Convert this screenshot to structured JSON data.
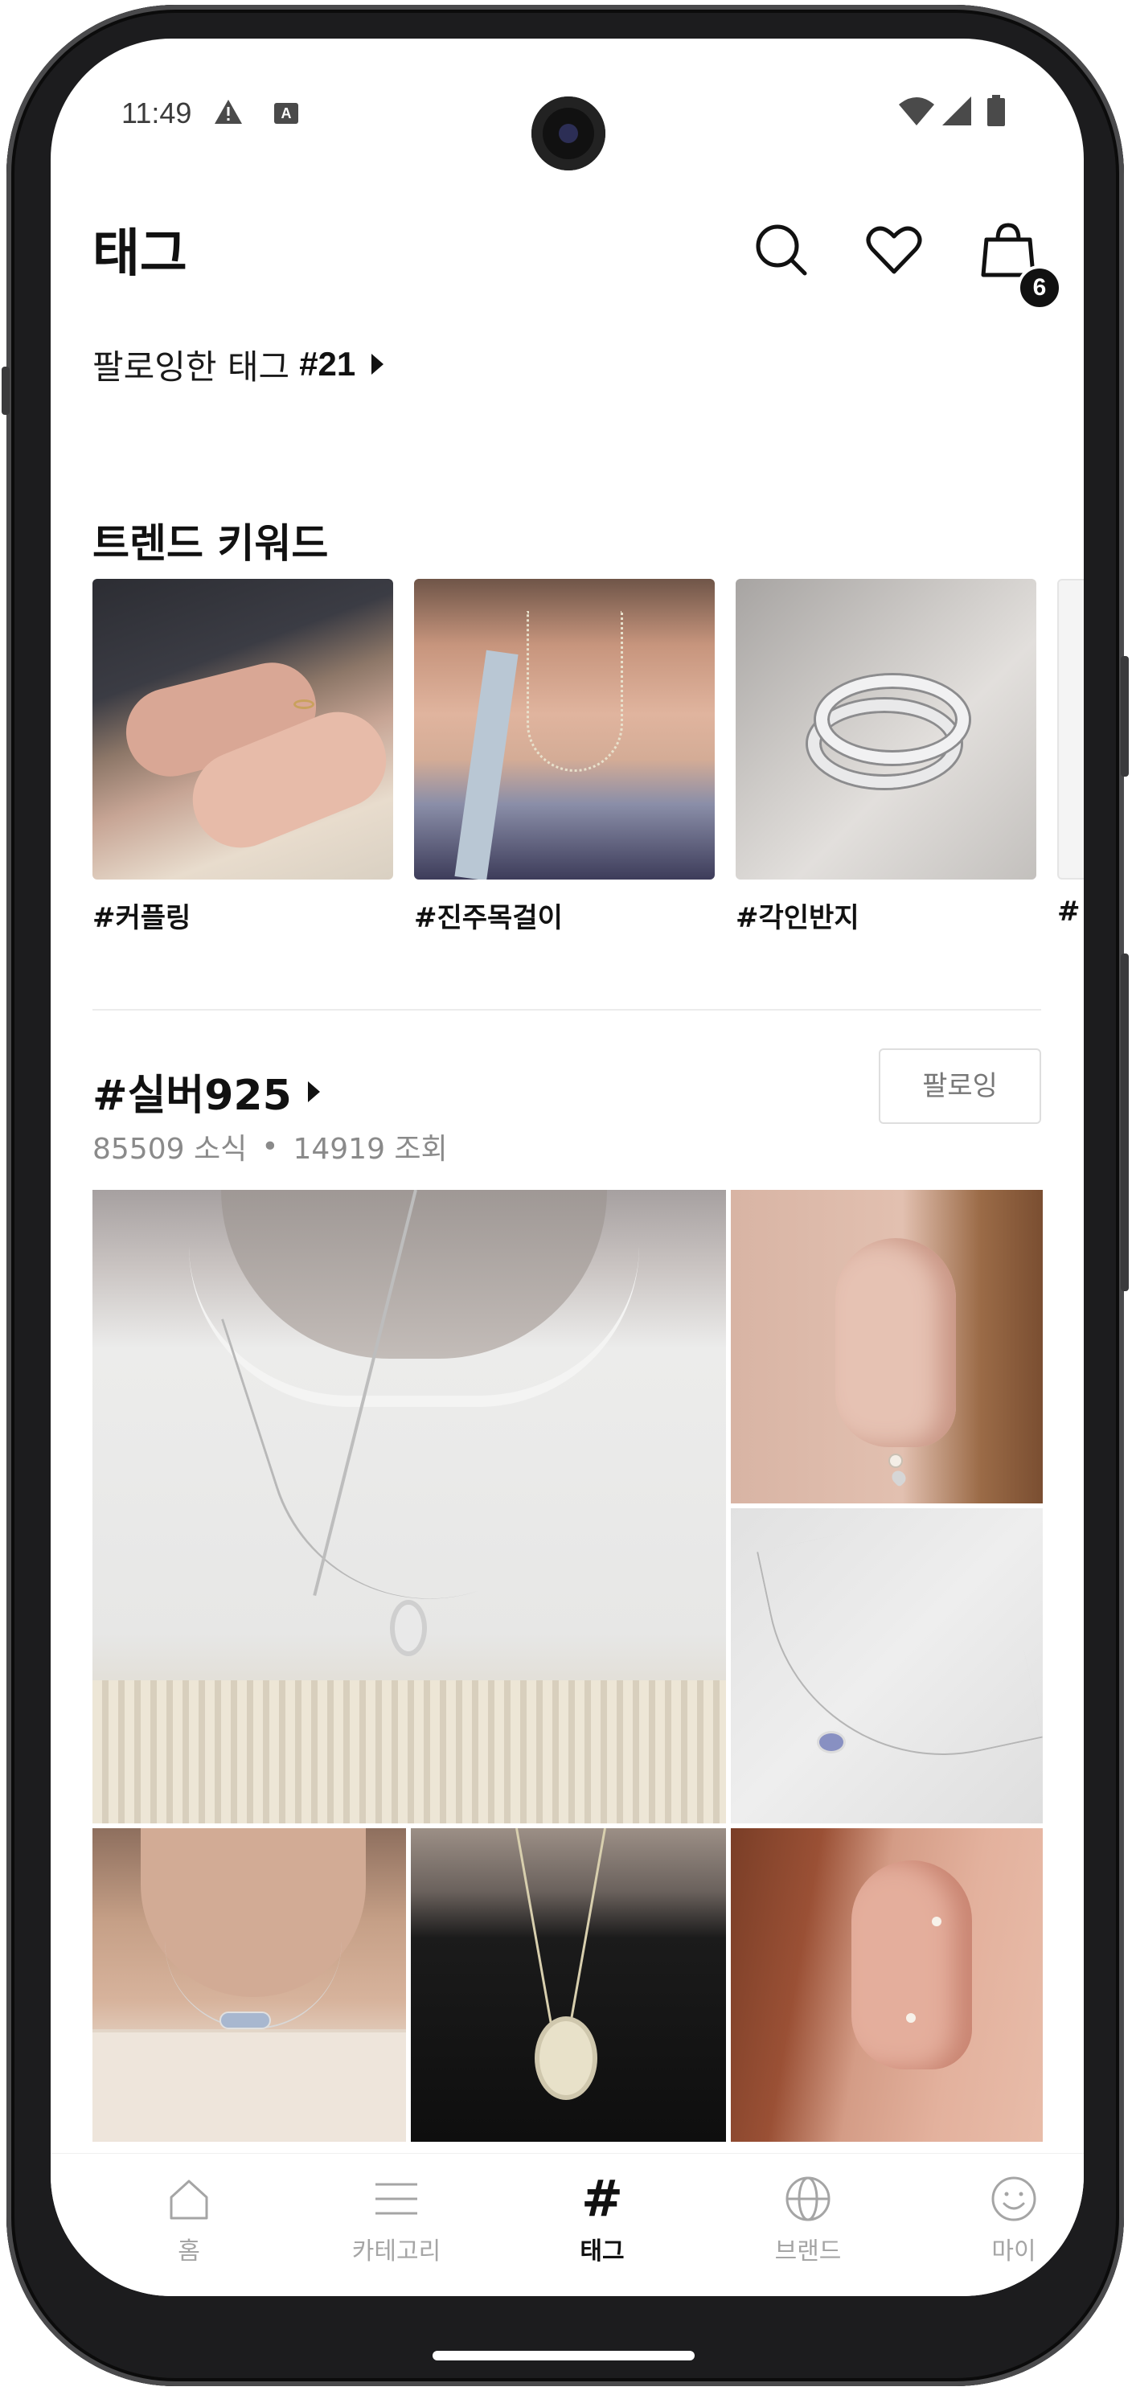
{
  "status_bar": {
    "time": "11:49",
    "indicator_a": "A"
  },
  "header": {
    "title": "태그",
    "cart_count": "6",
    "icons": [
      "search-icon",
      "heart-icon",
      "shopping-bag-icon"
    ]
  },
  "followed_tags": {
    "label": "팔로잉한 태그",
    "count": "#21"
  },
  "trend": {
    "title": "트렌드 키워드",
    "items": [
      {
        "label": "#커플링"
      },
      {
        "label": "#진주목걸이"
      },
      {
        "label": "#각인반지"
      },
      {
        "label": "#"
      }
    ]
  },
  "tag_section": {
    "title": "#실버925",
    "posts": "85509 소식",
    "separator": "•",
    "views": "14919 조회",
    "follow_label": "팔로잉"
  },
  "bottom_nav": {
    "active": "태그",
    "items": [
      {
        "label": "홈",
        "icon": "home-icon"
      },
      {
        "label": "카테고리",
        "icon": "menu-icon"
      },
      {
        "label": "태그",
        "icon": "hash-icon"
      },
      {
        "label": "브랜드",
        "icon": "globe-icon"
      },
      {
        "label": "마이",
        "icon": "smile-icon"
      }
    ]
  },
  "colors": {
    "text_primary": "#111111",
    "text_muted": "#8a8a8a",
    "nav_inactive": "#a5a5a5",
    "badge": "#111111"
  }
}
